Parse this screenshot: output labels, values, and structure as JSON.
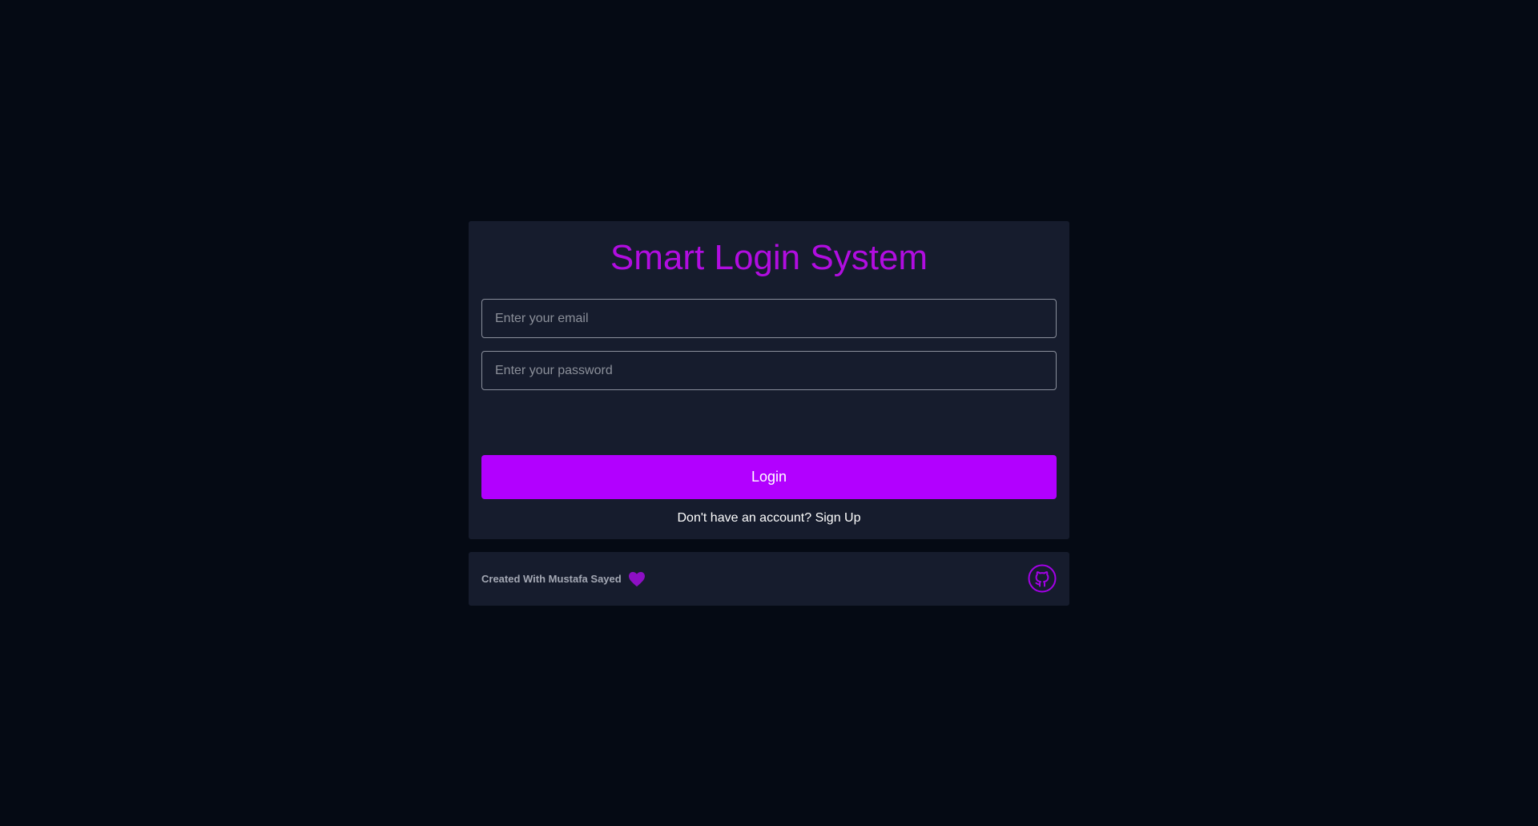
{
  "login_card": {
    "title": "Smart Login System",
    "email_placeholder": "Enter your email",
    "password_placeholder": "Enter your password",
    "login_label": "Login",
    "signup_prompt": "Don't have an account?",
    "signup_link": "Sign Up"
  },
  "footer": {
    "credit_text": "Created With Mustafa Sayed",
    "credit_icon": "heart-icon",
    "link_icon": "github-icon"
  },
  "colors": {
    "background": "#050a14",
    "card": "#161c2d",
    "accent": "#b200ff",
    "title": "#b10de0"
  }
}
